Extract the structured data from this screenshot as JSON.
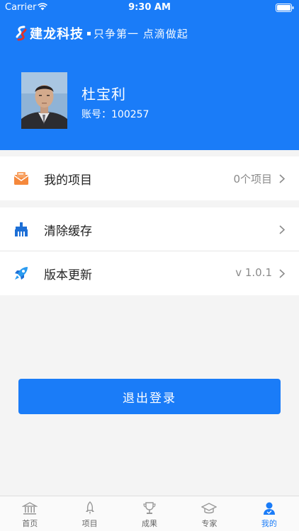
{
  "status_bar": {
    "carrier": "Carrier",
    "time": "9:30 AM"
  },
  "brand": {
    "name": "建龙科技",
    "slogan": "只争第一 点滴做起"
  },
  "profile": {
    "name": "杜宝利",
    "account": "账号：100257"
  },
  "menu": {
    "projects": {
      "label": "我的项目",
      "value": "0个项目",
      "icon": "envelope-icon"
    },
    "clear_cache": {
      "label": "清除缓存",
      "icon": "broom-icon"
    },
    "version": {
      "label": "版本更新",
      "value": "v 1.0.1",
      "icon": "rocket-icon"
    }
  },
  "logout_label": "退出登录",
  "tabs": [
    {
      "label": "首页",
      "icon": "bank-icon"
    },
    {
      "label": "项目",
      "icon": "rocket-icon"
    },
    {
      "label": "成果",
      "icon": "trophy-icon"
    },
    {
      "label": "专家",
      "icon": "graduation-cap-icon"
    },
    {
      "label": "我的",
      "icon": "person-icon"
    }
  ],
  "colors": {
    "primary": "#1a7cf8",
    "envelope": "#f5883c",
    "rocket": "#2a9bf0"
  }
}
